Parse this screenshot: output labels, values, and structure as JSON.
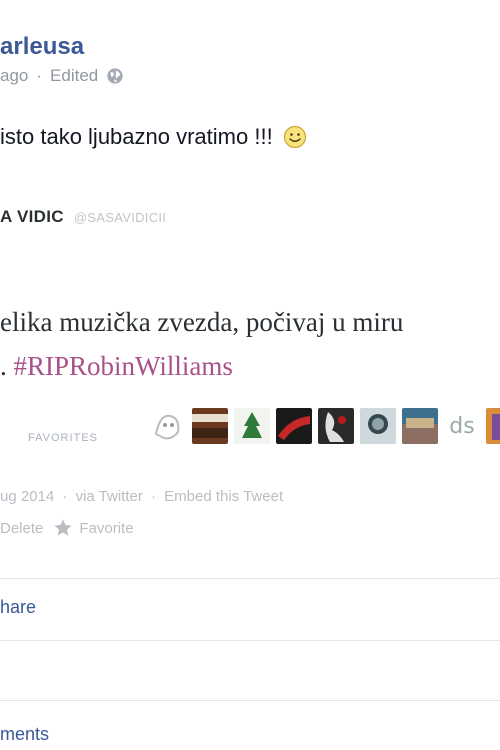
{
  "post": {
    "author": "arleusa",
    "time": "ago",
    "edited": "Edited",
    "privacy_icon": "globe-icon",
    "status_text": "isto tako ljubazno vratimo !!!",
    "emoji_icon": "smiley-icon"
  },
  "tweet": {
    "author_name": "A VIDIC",
    "handle": "@SASAVIDICII",
    "text_line1": "elika muzička zvezda, počivaj u miru",
    "text_line2_prefix": ". ",
    "hashtag": "#RIPRobinWilliams",
    "favorites_label": "FAVORITES",
    "date": "ug 2014",
    "via": "via Twitter",
    "embed": "Embed this Tweet",
    "delete": "Delete",
    "favorite": "Favorite",
    "star_icon": "star-icon"
  },
  "actions": {
    "share": "hare",
    "comments": "ments"
  },
  "colors": {
    "link": "#3b5998",
    "hashtag": "#a8518a",
    "muted": "#9197a3"
  }
}
